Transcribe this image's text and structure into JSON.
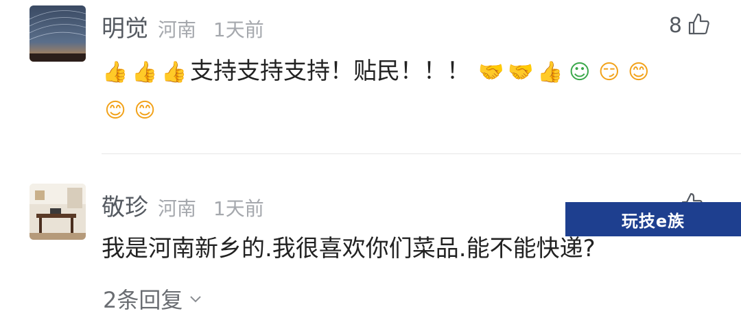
{
  "comments": [
    {
      "name": "明觉",
      "location": "河南",
      "time": "1天前",
      "likes": "8",
      "text": "支持支持支持！贴民！！！",
      "emojis_before": [
        "thumbs-up-icon",
        "thumbs-up-icon",
        "thumbs-up-icon"
      ],
      "emojis_after": [
        "handshake-icon",
        "handshake-icon",
        "thumbs-up-icon",
        "green-person-icon",
        "666-face-icon",
        "blushing-hand-face-icon",
        "blushing-hand-face-icon",
        "blushing-hand-face-icon"
      ]
    },
    {
      "name": "敬珍",
      "location": "河南",
      "time": "1天前",
      "text": "我是河南新乡的.我很喜欢你们菜品.能不能快递?",
      "replies": "2条回复"
    }
  ],
  "watermark": "玩技e族",
  "colors": {
    "name": "#555a61",
    "meta": "#a5a8ad",
    "text": "#222222",
    "watermark_bg": "#1e3f8f"
  }
}
